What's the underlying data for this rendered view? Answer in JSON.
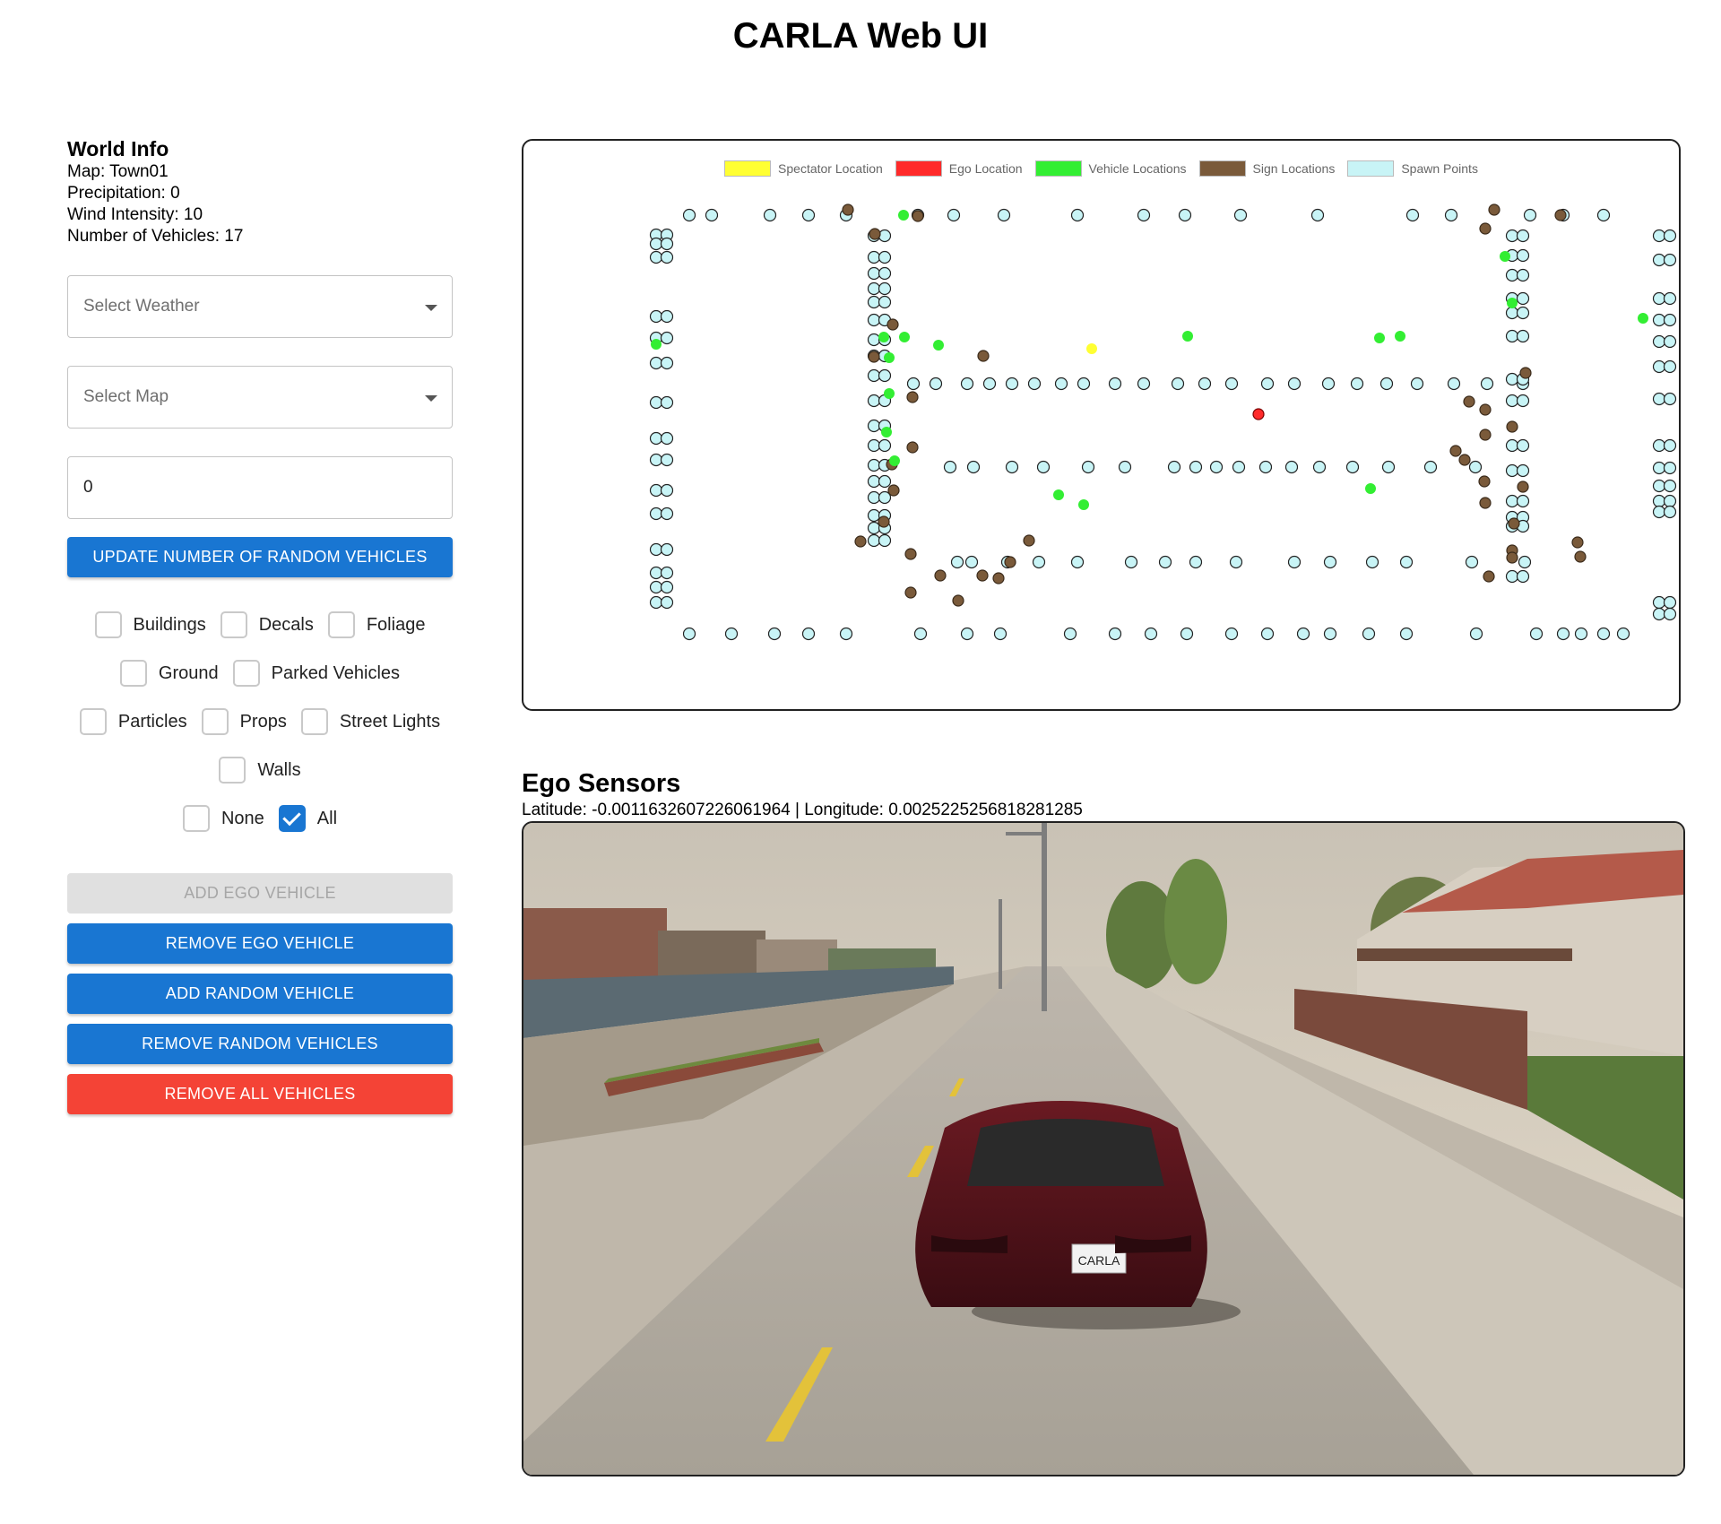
{
  "header": {
    "title": "CARLA Web UI"
  },
  "world_info": {
    "title": "World Info",
    "map_line": "Map: Town01",
    "precipitation_line": "Precipitation: 0",
    "wind_line": "Wind Intensity: 10",
    "vehicles_line": "Number of Vehicles: 17"
  },
  "controls": {
    "weather_placeholder": "Select Weather",
    "map_placeholder": "Select Map",
    "vehicle_count_value": "0",
    "update_button": "UPDATE NUMBER OF RANDOM VEHICLES"
  },
  "layers": {
    "buildings": {
      "label": "Buildings",
      "checked": false
    },
    "decals": {
      "label": "Decals",
      "checked": false
    },
    "foliage": {
      "label": "Foliage",
      "checked": false
    },
    "ground": {
      "label": "Ground",
      "checked": false
    },
    "parked_vehicles": {
      "label": "Parked Vehicles",
      "checked": false
    },
    "particles": {
      "label": "Particles",
      "checked": false
    },
    "props": {
      "label": "Props",
      "checked": false
    },
    "street_lights": {
      "label": "Street Lights",
      "checked": false
    },
    "walls": {
      "label": "Walls",
      "checked": false
    },
    "none": {
      "label": "None",
      "checked": false
    },
    "all": {
      "label": "All",
      "checked": true
    }
  },
  "buttons": {
    "add_ego": "ADD EGO VEHICLE",
    "remove_ego": "REMOVE EGO VEHICLE",
    "add_random": "ADD RANDOM VEHICLE",
    "remove_random": "REMOVE RANDOM VEHICLES",
    "remove_all": "REMOVE ALL VEHICLES"
  },
  "map_legend": [
    {
      "label": "Spectator Location",
      "color": "#ffff33"
    },
    {
      "label": "Ego Location",
      "color": "#ff2a2a"
    },
    {
      "label": "Vehicle Locations",
      "color": "#33ee33"
    },
    {
      "label": "Sign Locations",
      "color": "#7a5a3a"
    },
    {
      "label": "Spawn Points",
      "color": "#c8f4f6"
    }
  ],
  "ego_sensors": {
    "title": "Ego Sensors",
    "coordinates": "Latitude: -0.0011632607226061964 | Longitude: 0.0025225256818281285",
    "camera_icon": "camera-feed-image"
  }
}
